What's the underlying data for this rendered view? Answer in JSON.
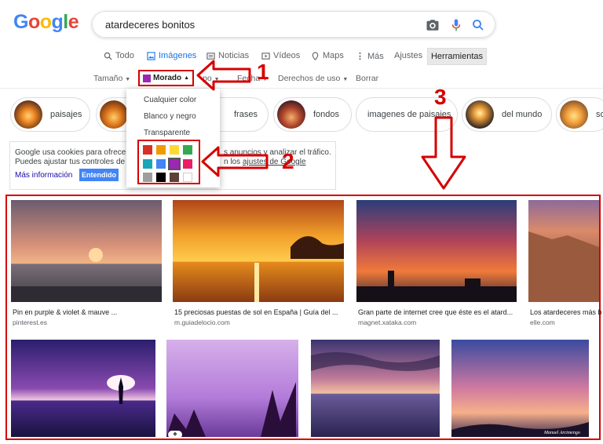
{
  "logo": [
    "G",
    "o",
    "o",
    "g",
    "l",
    "e"
  ],
  "logo_colors": [
    "#4285f4",
    "#ea4335",
    "#fbbc05",
    "#4285f4",
    "#34a853",
    "#ea4335"
  ],
  "search": {
    "query": "atardeceres bonitos",
    "camera_icon": "camera-icon",
    "mic_icon": "mic-icon",
    "search_icon": "search-icon"
  },
  "tabs": {
    "todo": "Todo",
    "imagenes": "Imágenes",
    "noticias": "Noticias",
    "videos": "Vídeos",
    "maps": "Maps",
    "mas": "Más",
    "ajustes": "Ajustes",
    "herramientas": "Herramientas"
  },
  "filters": {
    "tamano": "Tamaño",
    "color": "Morado",
    "tipo": "po",
    "fecha": "Fecha",
    "derechos": "Derechos de uso",
    "borrar": "Borrar"
  },
  "color_menu": {
    "options": [
      "Cualquier color",
      "Blanco y negro",
      "Transparente"
    ],
    "palette": [
      "#d93025",
      "#f29900",
      "#fdd835",
      "#34a853",
      "#1aa6b7",
      "#4285f4",
      "#9c27b0",
      "#e91e63",
      "#9e9e9e",
      "#000000",
      "#5d4037",
      "#ffffff"
    ],
    "selected_color": "#9c27b0"
  },
  "chips": [
    "paisajes",
    "",
    "frases",
    "fondos",
    "imagenes de paisajes",
    "del mundo",
    "so"
  ],
  "cookie": {
    "line1": "Google usa cookies para ofrecer",
    "line2": "Puedes ajustar tus controles de p",
    "line1_right": "s anuncios y analizar el tráfico.",
    "line2_right_prefix": "n los",
    "line2_right_link": "ajustes de Google",
    "more": "Más información",
    "ok": "Entendido"
  },
  "results_row1": [
    {
      "caption": "Pin en purple & violet & mauve ...",
      "source": "pinterest.es"
    },
    {
      "caption": "15 preciosas puestas de sol en España | Guía del ...",
      "source": "m.guiadelocio.com"
    },
    {
      "caption": "Gran parte de internet cree que éste es el atard...",
      "source": "magnet.xataka.com"
    },
    {
      "caption": "Los atardeceres más b",
      "source": "elle.com"
    }
  ],
  "results_row2": [
    {
      "caption": ""
    },
    {
      "caption": ""
    },
    {
      "caption": ""
    },
    {
      "caption": ""
    }
  ],
  "photo_credit": "Manuel Arcimengo",
  "annotations": {
    "a1": "1",
    "a2": "2",
    "a3": "3"
  },
  "accent_red": "#d50000"
}
